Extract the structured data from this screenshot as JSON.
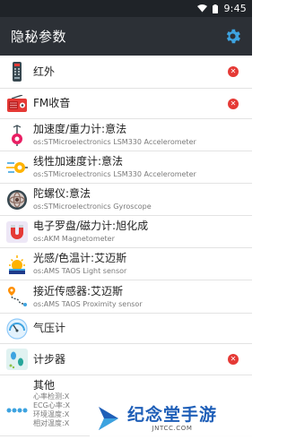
{
  "status_bar": {
    "time": "9:45",
    "icons": [
      "wifi-icon",
      "battery-icon"
    ]
  },
  "app_bar": {
    "title": "隐秘参数",
    "action_icon": "gear-icon"
  },
  "sensors": [
    {
      "title": "红外",
      "subtitle": "",
      "icon": "remote-control-icon",
      "unavailable": true
    },
    {
      "title": "FM收音",
      "subtitle": "",
      "icon": "radio-icon",
      "unavailable": true
    },
    {
      "title": "加速度/重力计:意法",
      "subtitle": "os:STMicroelectronics LSM330 Accelerometer",
      "icon": "accelerometer-icon",
      "unavailable": false
    },
    {
      "title": "线性加速度计:意法",
      "subtitle": "os:STMicroelectronics LSM330 Accelerometer",
      "icon": "linear-acceleration-icon",
      "unavailable": false
    },
    {
      "title": "陀螺仪:意法",
      "subtitle": "os:STMicroelectronics Gyroscope",
      "icon": "gyroscope-icon",
      "unavailable": false
    },
    {
      "title": "电子罗盘/磁力计:旭化成",
      "subtitle": "os:AKM Magnetometer",
      "icon": "magnet-icon",
      "unavailable": false
    },
    {
      "title": "光感/色温计:艾迈斯",
      "subtitle": "os:AMS TAOS Light sensor",
      "icon": "light-sensor-icon",
      "unavailable": false
    },
    {
      "title": "接近传感器:艾迈斯",
      "subtitle": "os:AMS TAOS Proximity sensor",
      "icon": "proximity-icon",
      "unavailable": false
    },
    {
      "title": "气压计",
      "subtitle": "",
      "icon": "barometer-icon",
      "unavailable": false
    },
    {
      "title": "计步器",
      "subtitle": "",
      "icon": "pedometer-icon",
      "unavailable": true
    }
  ],
  "other": {
    "title": "其他",
    "lines": [
      "心率检测:X",
      "ECG心率:X",
      "环境温度:X",
      "相对温度:X"
    ],
    "icon": "more-dots-icon"
  },
  "watermark": {
    "name": "纪念堂手游",
    "url": "JNTCC.COM"
  },
  "colors": {
    "app_bar": "#2c3036",
    "status_bar": "#1f2328",
    "accent": "#3da3e0",
    "unavailable": "#e53935"
  }
}
